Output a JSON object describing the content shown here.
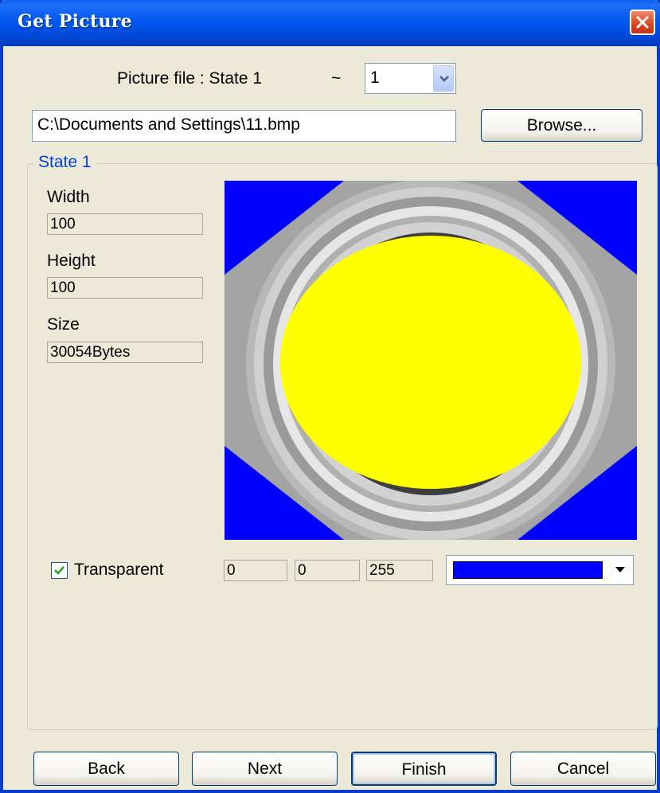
{
  "window": {
    "title": "Get Picture"
  },
  "picture_file": {
    "label": "Picture file : State  1",
    "tilde": "~",
    "state_select_value": "1"
  },
  "path": {
    "value": "C:\\Documents and Settings\\11.bmp"
  },
  "browse_label": "Browse...",
  "group": {
    "title": "State 1"
  },
  "width": {
    "label": "Width",
    "value": "100"
  },
  "height": {
    "label": "Height",
    "value": "100"
  },
  "size": {
    "label": "Size",
    "value": "30054Bytes"
  },
  "transparent": {
    "label": "Transparent",
    "checked": true,
    "r": "0",
    "g": "0",
    "b": "255",
    "color": "#0000FF"
  },
  "buttons": {
    "back": "Back",
    "next": "Next",
    "finish": "Finish",
    "cancel": "Cancel"
  },
  "colors": {
    "titlebar": "#0058EE",
    "dialog_bg": "#ECE9D8",
    "group_title": "#0046D5",
    "preview_bg": "#0000FF",
    "preview_center": "#FFFF00"
  },
  "icons": {
    "close": "close-icon",
    "dropdown": "chevron-down-icon",
    "check": "check-icon"
  }
}
